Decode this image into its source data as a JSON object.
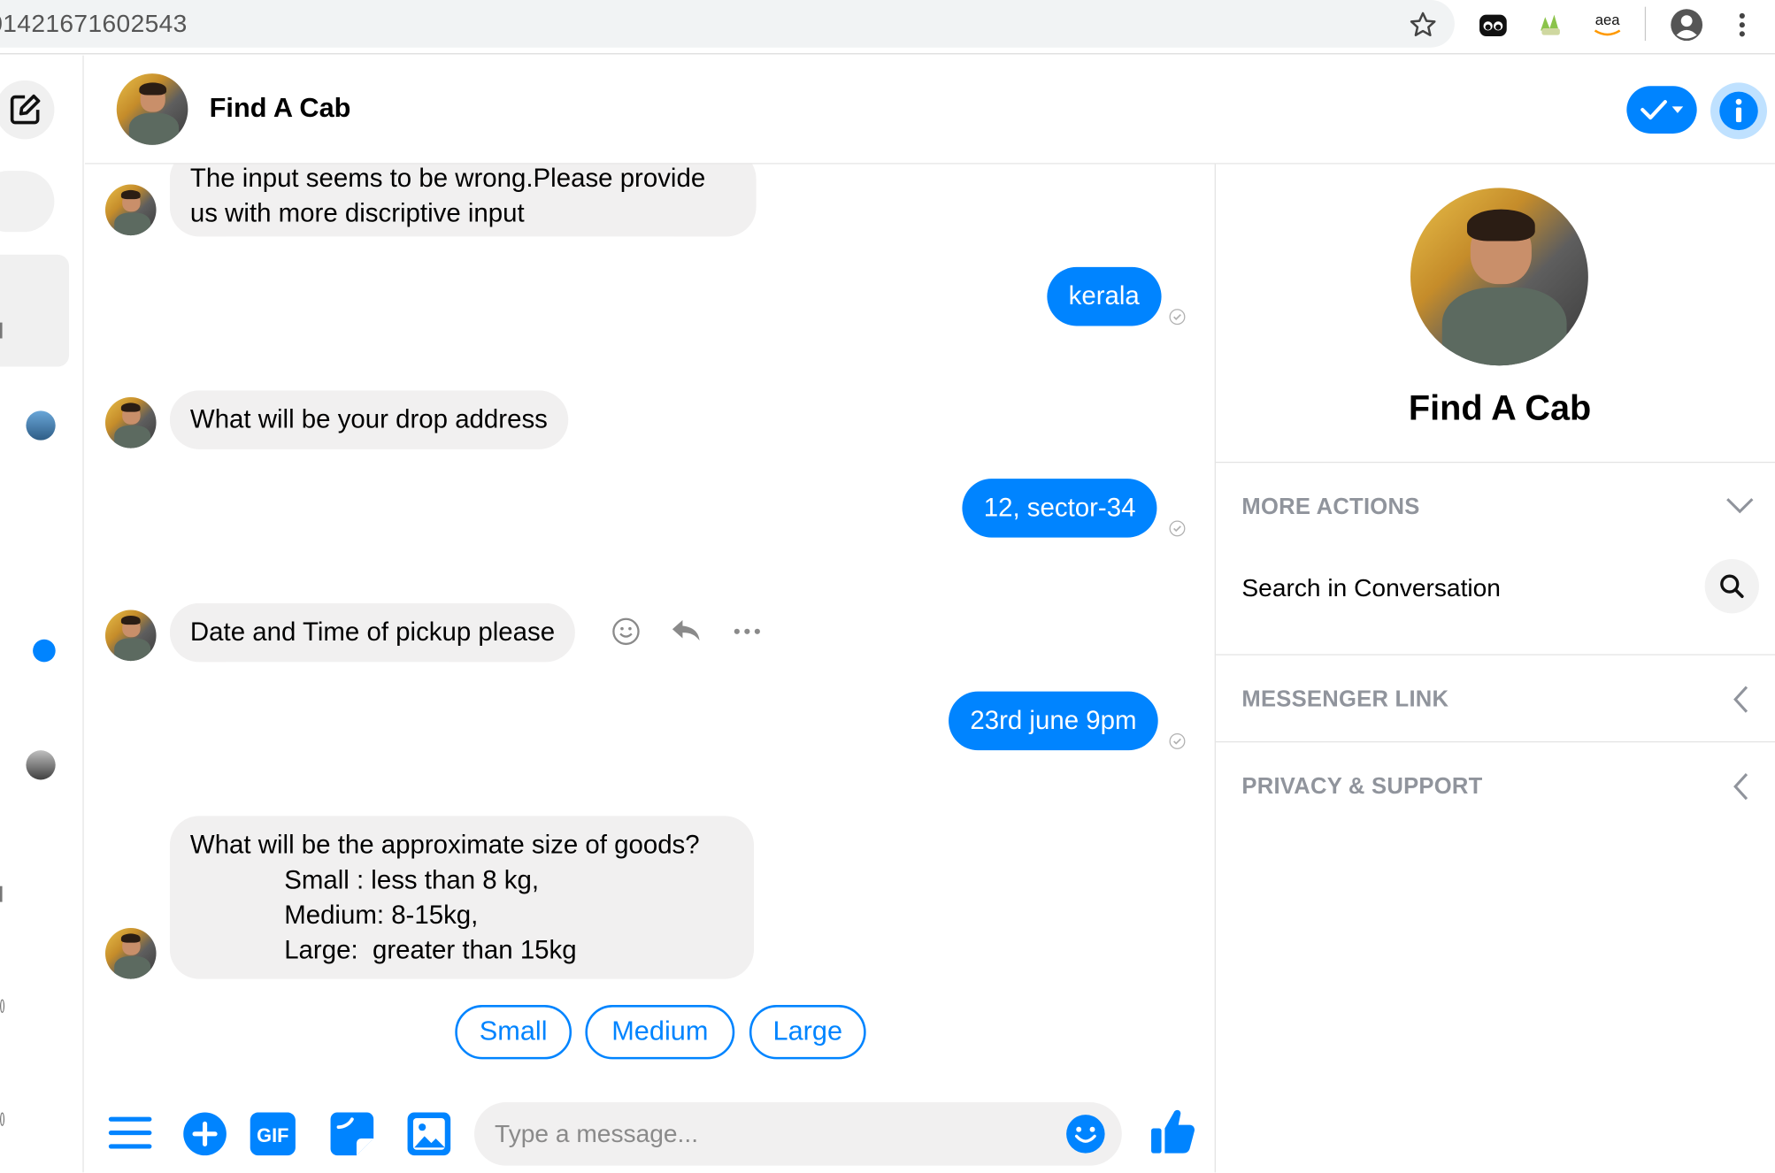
{
  "browser": {
    "url_fragment": "01421671602543",
    "extension_badge": "aea"
  },
  "header": {
    "title": "Find A Cab"
  },
  "messages": {
    "m1": "The input seems to be wrong.Please provide\nus with more discriptive input",
    "m2": "kerala",
    "m3": "What will be your drop address",
    "m4": "12, sector-34",
    "m5": "Date and Time of pickup please",
    "m6": "23rd june 9pm",
    "m7": "What will be the approximate size of goods?\n             Small : less than 8 kg,\n             Medium: 8-15kg,\n             Large:  greater than 15kg"
  },
  "quick_replies": [
    "Small",
    "Medium",
    "Large"
  ],
  "composer": {
    "placeholder": "Type a message..."
  },
  "right_panel": {
    "name": "Find A Cab",
    "more_actions": "MORE ACTIONS",
    "search": "Search in Conversation",
    "messenger_link": "MESSENGER LINK",
    "privacy": "PRIVACY & SUPPORT"
  },
  "colors": {
    "accent": "#0084ff",
    "incoming_bubble": "#f1f0f0",
    "section_label": "#90949c"
  },
  "icons": [
    "star-icon",
    "extension-icon",
    "grass-extension-icon",
    "amazon-icon",
    "profile-icon",
    "kebab-menu-icon",
    "compose-icon",
    "check-dropdown-icon",
    "info-icon",
    "emoji-icon",
    "reply-icon",
    "more-icon",
    "menu-icon",
    "plus-icon",
    "gif-icon",
    "sticker-icon",
    "image-icon",
    "smiley-icon",
    "thumbs-up-icon",
    "chevron-down-icon",
    "chevron-left-icon",
    "search-icon",
    "seen-icon"
  ]
}
